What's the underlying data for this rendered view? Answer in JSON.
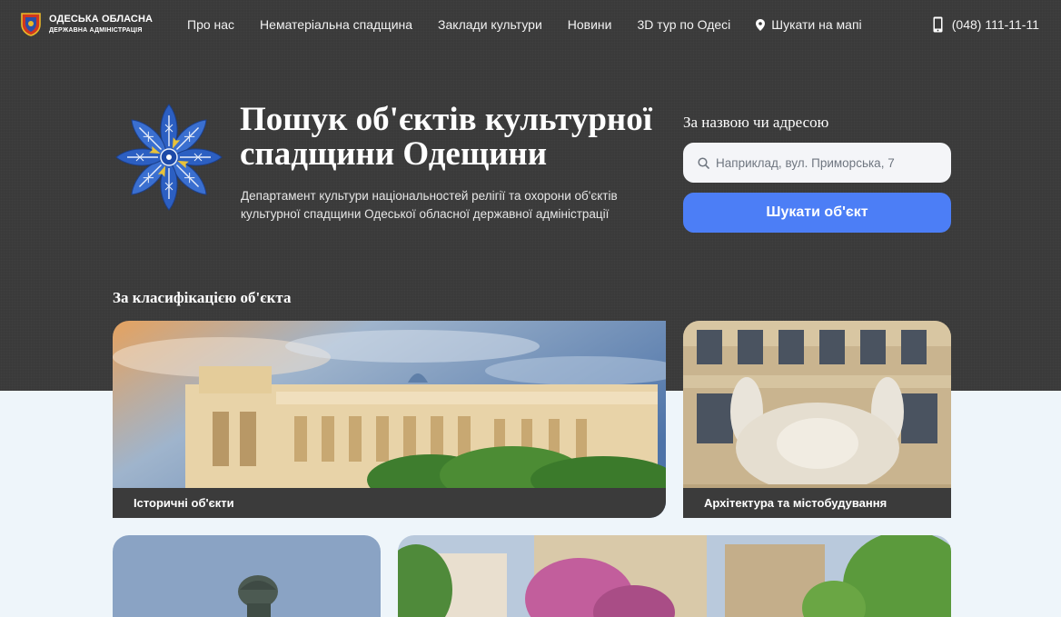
{
  "header": {
    "brand_line1": "ОДЕСЬКА ОБЛАСНА",
    "brand_line2": "ДЕРЖАВНА АДМІНІСТРАЦІЯ",
    "nav": [
      {
        "label": "Про нас"
      },
      {
        "label": "Нематеріальна спадщина"
      },
      {
        "label": "Заклади культури"
      },
      {
        "label": "Новини"
      },
      {
        "label": "3D тур по Одесі"
      },
      {
        "label": "Шукати на мапі",
        "icon": "map-pin-icon"
      }
    ],
    "phone": "(048) 111-11-11"
  },
  "hero": {
    "title_line1": "Пошук об'єктів культурної",
    "title_line2": "спадщини Одещини",
    "subtitle_line1": "Департамент культури національностей релігії та охорони об'єктів",
    "subtitle_line2": "культурної спадщини Одеської обласної державної адміністрації"
  },
  "search": {
    "label": "За назвою чи адресою",
    "placeholder": "Наприклад, вул. Приморська, 7",
    "value": "",
    "button_label": "Шукати об'єкт"
  },
  "classification": {
    "title": "За класифікацією об'єкта",
    "cards": [
      {
        "label": "Історичні об'єкти"
      },
      {
        "label": "Архітектура та містобудування"
      },
      {
        "label": ""
      },
      {
        "label": ""
      }
    ]
  },
  "colors": {
    "hero_bg": "#3a3a3a",
    "page_bg": "#eef5fa",
    "accent": "#4c7ef6",
    "card_label_bg": "#3b3b3b"
  }
}
